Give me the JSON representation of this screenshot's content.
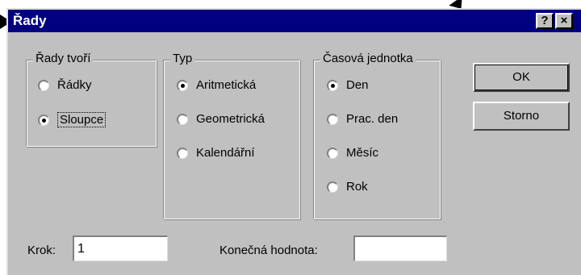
{
  "window": {
    "title": "Řady",
    "help_label": "?",
    "close_label": "×"
  },
  "groups": {
    "series_in": {
      "label": "Řady tvoří",
      "options": [
        "Řádky",
        "Sloupce"
      ],
      "selected": "Sloupce"
    },
    "type": {
      "label": "Typ",
      "options": [
        "Aritmetická",
        "Geometrická",
        "Kalendářní"
      ],
      "selected": "Aritmetická"
    },
    "date_unit": {
      "label": "Časová jednotka",
      "options": [
        "Den",
        "Prac. den",
        "Měsíc",
        "Rok"
      ],
      "selected": "Den"
    }
  },
  "buttons": {
    "ok": "OK",
    "cancel": "Storno"
  },
  "step": {
    "label": "Krok:",
    "value": "1"
  },
  "stop_value": {
    "label": "Konečná hodnota:",
    "value": ""
  }
}
